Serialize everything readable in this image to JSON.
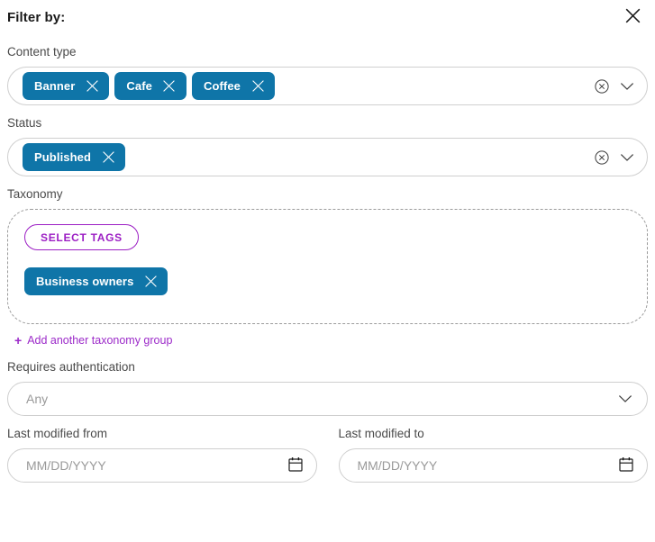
{
  "header": {
    "title": "Filter by:",
    "close_icon": "close-icon"
  },
  "content_type": {
    "label": "Content type",
    "chips": [
      {
        "label": "Banner",
        "remove_icon": "close-icon"
      },
      {
        "label": "Cafe",
        "remove_icon": "close-icon"
      },
      {
        "label": "Coffee",
        "remove_icon": "close-icon"
      }
    ],
    "clear_icon": "circle-x-icon",
    "expand_icon": "chevron-down-icon"
  },
  "status": {
    "label": "Status",
    "chips": [
      {
        "label": "Published",
        "remove_icon": "close-icon"
      }
    ],
    "clear_icon": "circle-x-icon",
    "expand_icon": "chevron-down-icon"
  },
  "taxonomy": {
    "label": "Taxonomy",
    "select_tags_label": "SELECT TAGS",
    "chips": [
      {
        "label": "Business owners",
        "remove_icon": "close-icon"
      }
    ],
    "add_group_label": "Add another taxonomy group",
    "add_group_icon": "plus-icon"
  },
  "requires_authentication": {
    "label": "Requires authentication",
    "value": "Any",
    "expand_icon": "chevron-down-icon"
  },
  "last_modified_from": {
    "label": "Last modified from",
    "value": "",
    "placeholder": "MM/DD/YYYY",
    "calendar_icon": "calendar-icon"
  },
  "last_modified_to": {
    "label": "Last modified to",
    "value": "",
    "placeholder": "MM/DD/YYYY",
    "calendar_icon": "calendar-icon"
  },
  "colors": {
    "chip_blue": "#0f75a8",
    "accent_purple": "#9c1fc4",
    "border_grey": "#cfcfcf",
    "dashed_border": "#9b9b9b",
    "text_dark": "#1a1a1a",
    "text_muted": "#9a9a9a"
  }
}
